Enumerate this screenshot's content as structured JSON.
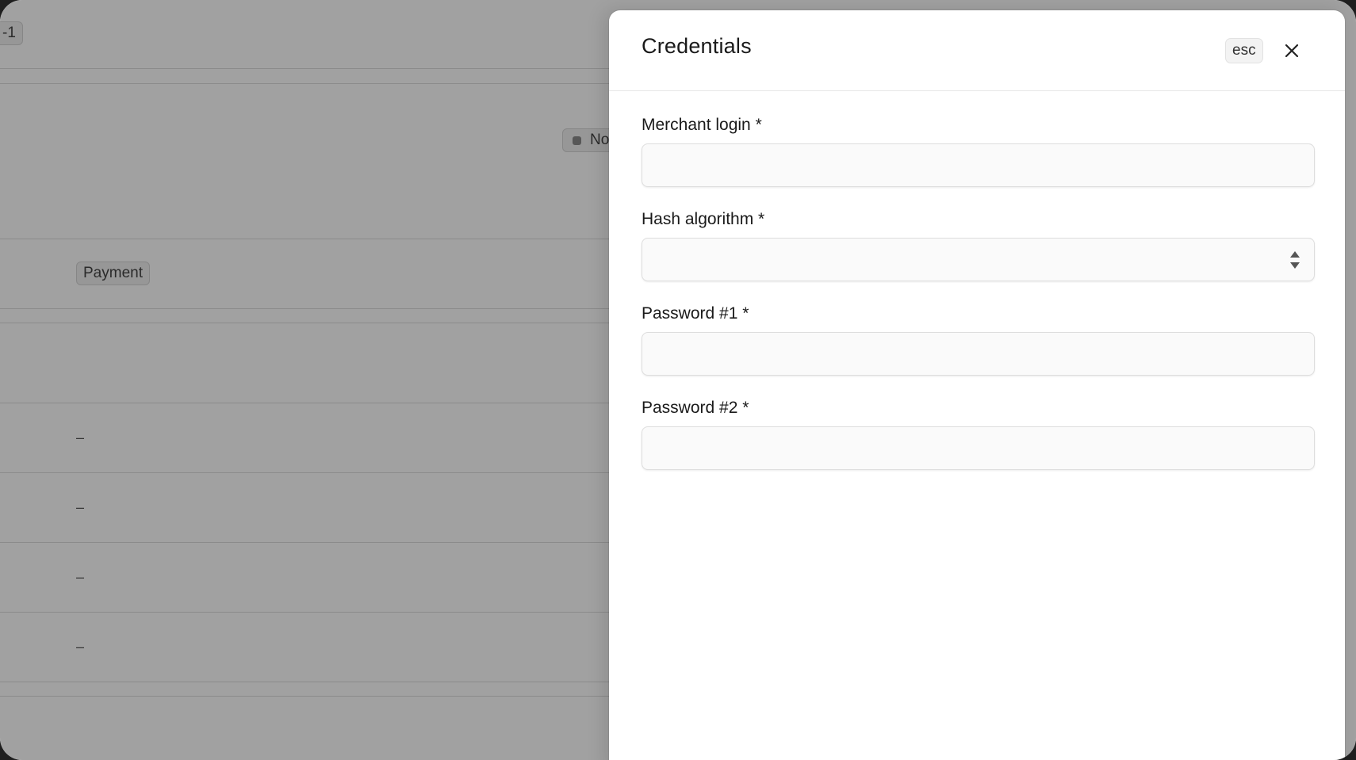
{
  "background": {
    "top_chip": "-1",
    "status_chip": "No",
    "type_chip": "Payment",
    "dash_values": [
      "–",
      "–",
      "–",
      "–"
    ]
  },
  "drawer": {
    "title": "Credentials",
    "esc_label": "esc",
    "close_icon": "close-icon",
    "fields": [
      {
        "label": "Merchant login *",
        "value": "",
        "type": "text"
      },
      {
        "label": "Hash algorithm *",
        "value": "",
        "type": "select"
      },
      {
        "label": "Password #1 *",
        "value": "",
        "type": "text"
      },
      {
        "label": "Password #2 *",
        "value": "",
        "type": "text"
      }
    ]
  }
}
